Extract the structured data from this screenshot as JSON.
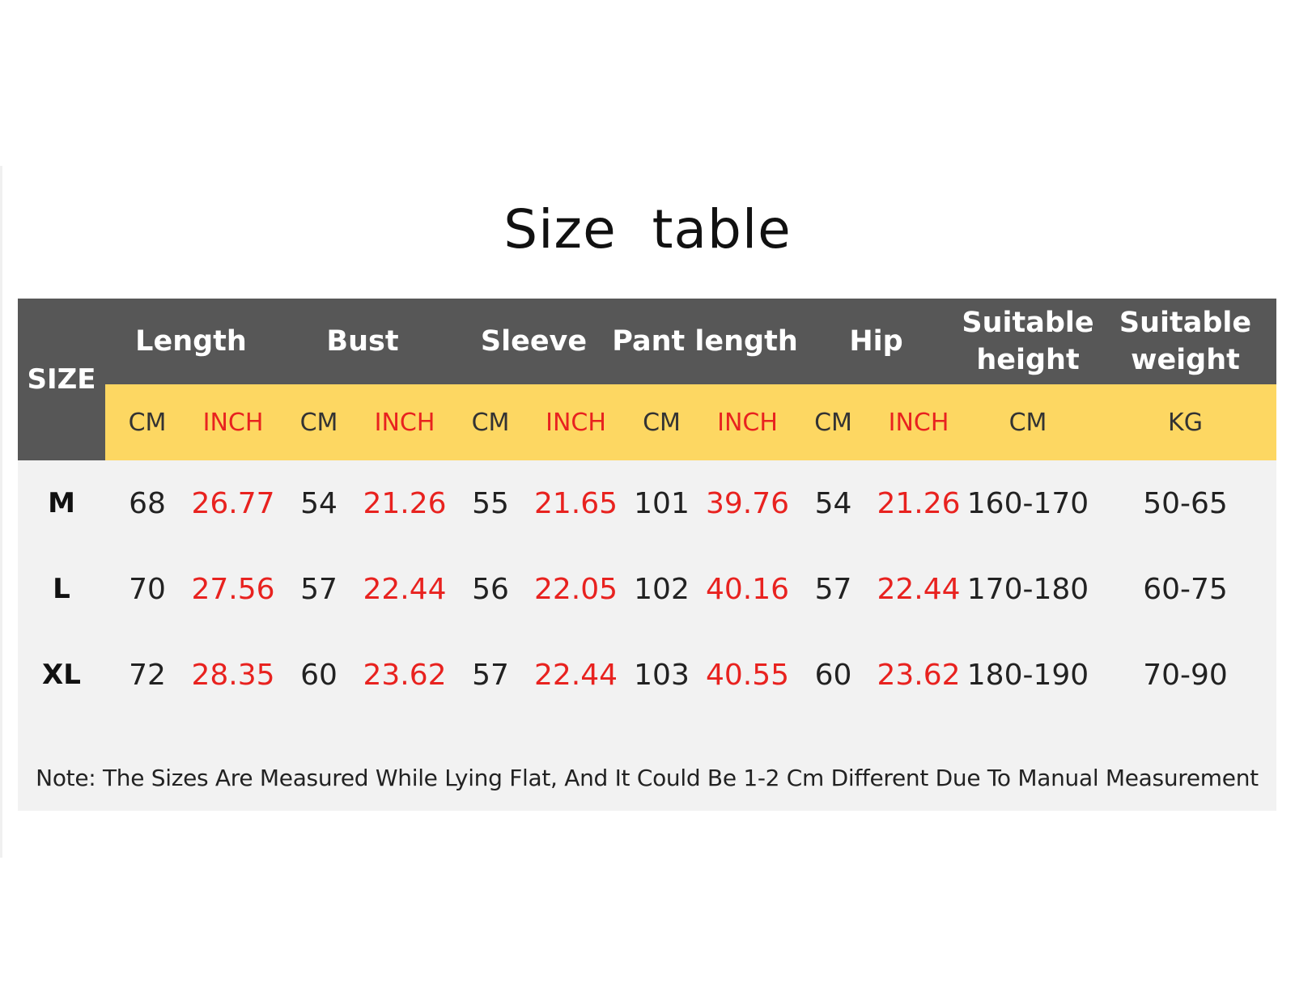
{
  "title": "Size  table",
  "header": {
    "size_label": "SIZE",
    "groups": [
      {
        "label": "Length",
        "units": [
          "CM",
          "INCH"
        ]
      },
      {
        "label": "Bust",
        "units": [
          "CM",
          "INCH"
        ]
      },
      {
        "label": "Sleeve",
        "units": [
          "CM",
          "INCH"
        ]
      },
      {
        "label": "Pant length",
        "units": [
          "CM",
          "INCH"
        ]
      },
      {
        "label": "Hip",
        "units": [
          "CM",
          "INCH"
        ]
      },
      {
        "label": "Suitable height",
        "units": [
          "CM"
        ]
      },
      {
        "label": "Suitable weight",
        "units": [
          "KG"
        ]
      }
    ]
  },
  "rows": [
    {
      "size": "M",
      "values": [
        "68",
        "26.77",
        "54",
        "21.26",
        "55",
        "21.65",
        "101",
        "39.76",
        "54",
        "21.26",
        "160-170",
        "50-65"
      ]
    },
    {
      "size": "L",
      "values": [
        "70",
        "27.56",
        "57",
        "22.44",
        "56",
        "22.05",
        "102",
        "40.16",
        "57",
        "22.44",
        "170-180",
        "60-75"
      ]
    },
    {
      "size": "XL",
      "values": [
        "72",
        "28.35",
        "60",
        "23.62",
        "57",
        "22.44",
        "103",
        "40.55",
        "60",
        "23.62",
        "180-190",
        "70-90"
      ]
    }
  ],
  "note": "Note: The Sizes Are Measured While Lying Flat, And It Could Be 1-2 Cm Different Due To Manual Measurement",
  "colors": {
    "header_bg": "#575757",
    "unit_band_bg": "#fdd762",
    "body_bg": "#f2f2f2",
    "inch_text": "#e8221f"
  }
}
